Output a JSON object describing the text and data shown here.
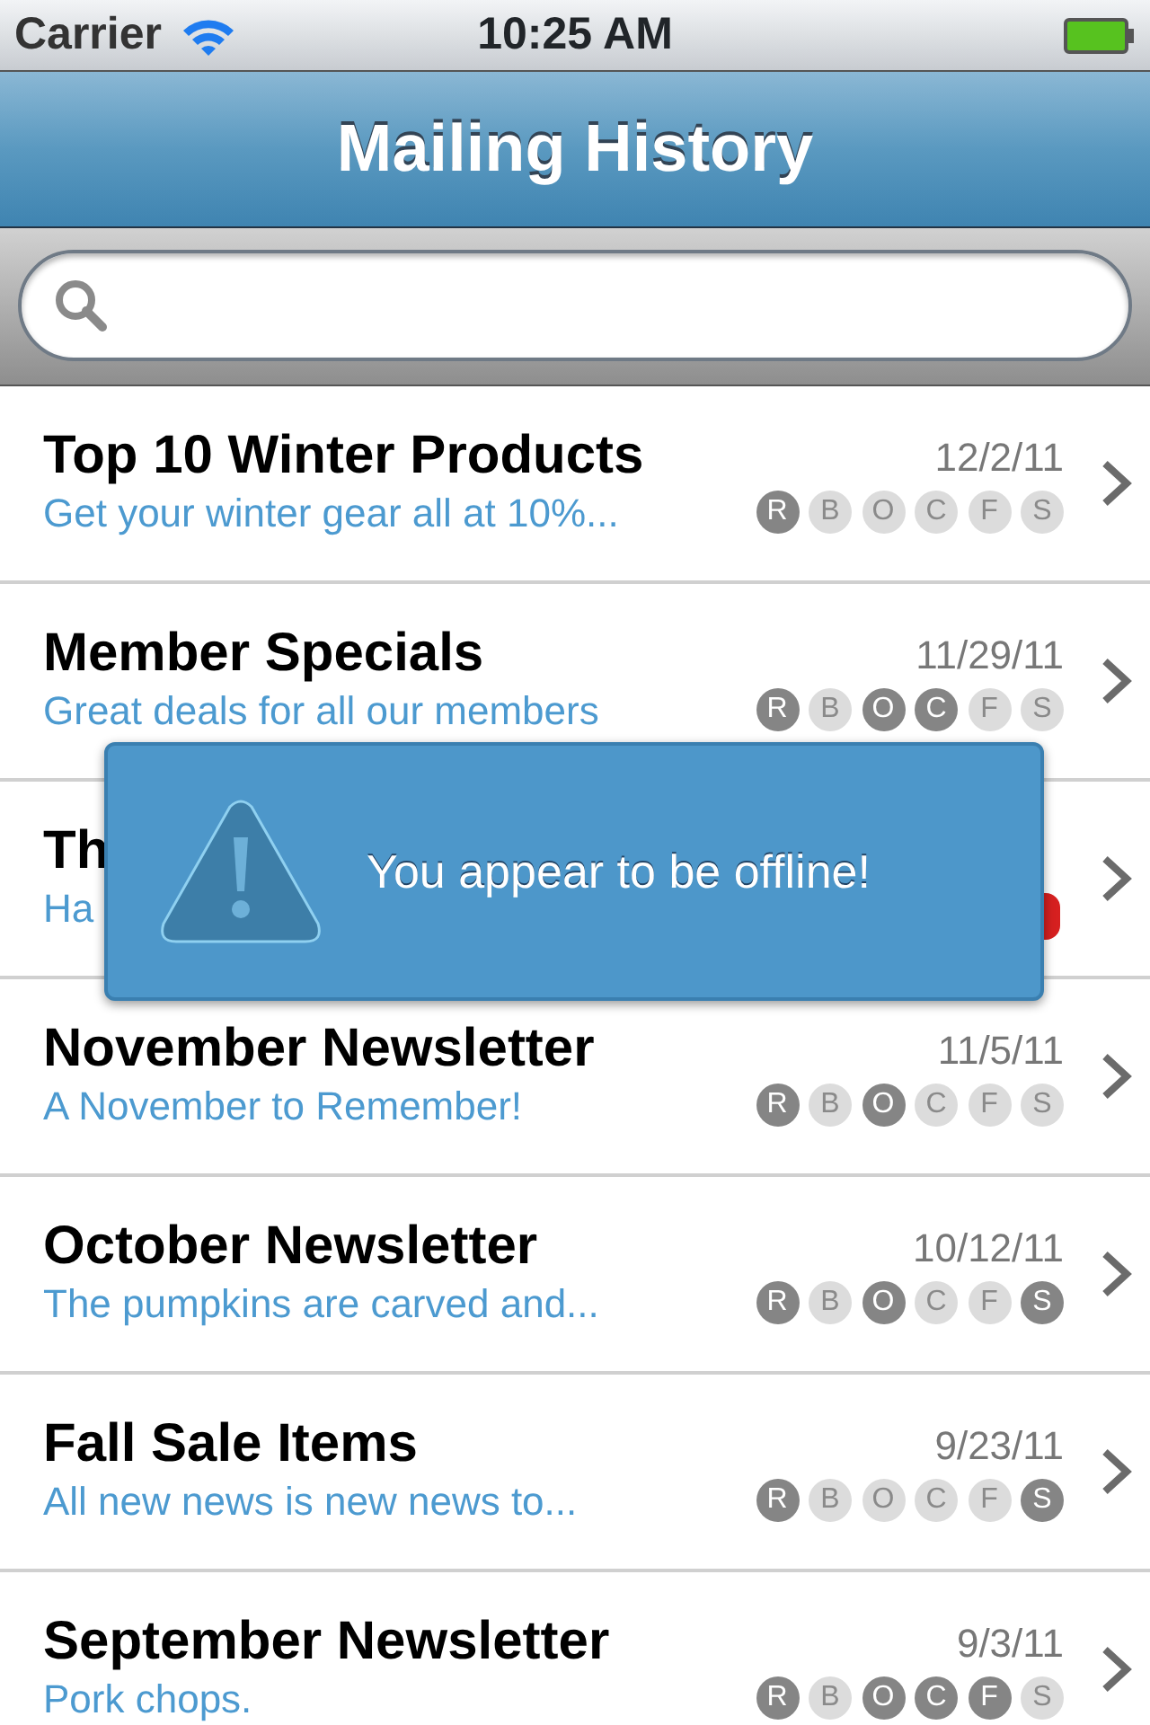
{
  "status_bar": {
    "carrier": "Carrier",
    "time": "10:25 AM"
  },
  "nav_bar": {
    "title": "Mailing History"
  },
  "mailings": [
    {
      "title": "Top 10 Winter Products",
      "subtitle": "Get your winter gear all at 10%...",
      "date": "12/2/11",
      "kind": "flags",
      "flags": [
        {
          "letter": "R",
          "on": true
        },
        {
          "letter": "B",
          "on": false
        },
        {
          "letter": "O",
          "on": false
        },
        {
          "letter": "C",
          "on": false
        },
        {
          "letter": "F",
          "on": false
        },
        {
          "letter": "S",
          "on": false
        }
      ]
    },
    {
      "title": "Member Specials",
      "subtitle": "Great deals for all our members",
      "date": "11/29/11",
      "kind": "flags",
      "flags": [
        {
          "letter": "R",
          "on": true
        },
        {
          "letter": "B",
          "on": false
        },
        {
          "letter": "O",
          "on": true
        },
        {
          "letter": "C",
          "on": true
        },
        {
          "letter": "F",
          "on": false
        },
        {
          "letter": "S",
          "on": false
        }
      ]
    },
    {
      "title": "Th",
      "subtitle": "Ha",
      "kind": "status"
    },
    {
      "title": "November Newsletter",
      "subtitle": "A November to Remember!",
      "date": "11/5/11",
      "kind": "flags",
      "flags": [
        {
          "letter": "R",
          "on": true
        },
        {
          "letter": "B",
          "on": false
        },
        {
          "letter": "O",
          "on": true
        },
        {
          "letter": "C",
          "on": false
        },
        {
          "letter": "F",
          "on": false
        },
        {
          "letter": "S",
          "on": false
        }
      ]
    },
    {
      "title": "October Newsletter",
      "subtitle": "The pumpkins are carved and...",
      "date": "10/12/11",
      "kind": "flags",
      "flags": [
        {
          "letter": "R",
          "on": true
        },
        {
          "letter": "B",
          "on": false
        },
        {
          "letter": "O",
          "on": true
        },
        {
          "letter": "C",
          "on": false
        },
        {
          "letter": "F",
          "on": false
        },
        {
          "letter": "S",
          "on": true
        }
      ]
    },
    {
      "title": "Fall Sale Items",
      "subtitle": "All new news is new news to...",
      "date": "9/23/11",
      "kind": "flags",
      "flags": [
        {
          "letter": "R",
          "on": true
        },
        {
          "letter": "B",
          "on": false
        },
        {
          "letter": "O",
          "on": false
        },
        {
          "letter": "C",
          "on": false
        },
        {
          "letter": "F",
          "on": false
        },
        {
          "letter": "S",
          "on": true
        }
      ]
    },
    {
      "title": "September Newsletter",
      "subtitle": "Pork chops.",
      "date": "9/3/11",
      "kind": "flags",
      "flags": [
        {
          "letter": "R",
          "on": true
        },
        {
          "letter": "B",
          "on": false
        },
        {
          "letter": "O",
          "on": true
        },
        {
          "letter": "C",
          "on": true
        },
        {
          "letter": "F",
          "on": true
        },
        {
          "letter": "S",
          "on": false
        }
      ]
    }
  ],
  "alert": {
    "message": "You appear to be offline!"
  }
}
